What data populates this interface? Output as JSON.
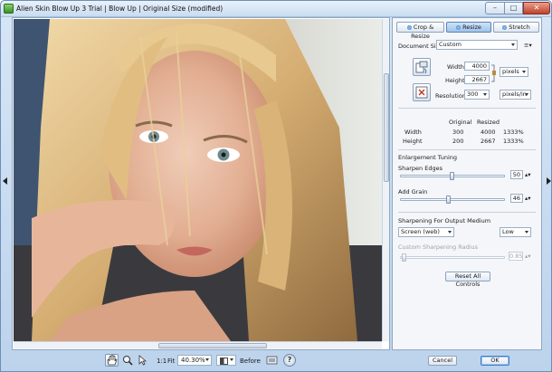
{
  "window": {
    "title": "Alien Skin Blow Up 3 Trial | Blow Up | Original Size (modified)",
    "min_glyph": "–",
    "max_glyph": "□",
    "close_glyph": "✕"
  },
  "toolbar": {
    "ratio_label": "1:1",
    "fit_label": "Fit",
    "zoom_value": "40.30%",
    "before_label": "Before",
    "help_glyph": "?"
  },
  "panel": {
    "tabs": [
      {
        "label": "Crop & Resize"
      },
      {
        "label": "Resize"
      },
      {
        "label": "Stretch"
      }
    ],
    "document_size_label": "Document Size",
    "document_size_value": "Custom",
    "menu_glyph": "≡▾",
    "width_label": "Width",
    "width_value": "4000",
    "height_label": "Height",
    "height_value": "2667",
    "unit_value": "pixels",
    "resolution_label": "Resolution",
    "resolution_value": "300",
    "resolution_unit": "pixels/in",
    "table": {
      "headers": [
        "",
        "Original",
        "Resized"
      ],
      "rows": [
        [
          "Width",
          "300",
          "4000",
          "1333%"
        ],
        [
          "Height",
          "200",
          "2667",
          "1333%"
        ]
      ]
    },
    "enlargement_title": "Enlargement Tuning",
    "sharpen_label": "Sharpen Edges",
    "sharpen_value": "50",
    "sharpen_level": 0.5,
    "grain_label": "Add Grain",
    "grain_value": "46",
    "grain_level": 0.46,
    "output_title": "Sharpening For Output Medium",
    "medium_value": "Screen (web)",
    "strength_value": "Low",
    "radius_label": "Custom Sharpening Radius",
    "radius_value": "0.85",
    "reset_label": "Reset All Controls"
  },
  "buttons": {
    "cancel": "Cancel",
    "ok": "OK"
  },
  "colors": {
    "window_frame": "#bcd3ec",
    "active_tab": "#9fc3ea",
    "ok_highlight": "#3c7fd1"
  }
}
